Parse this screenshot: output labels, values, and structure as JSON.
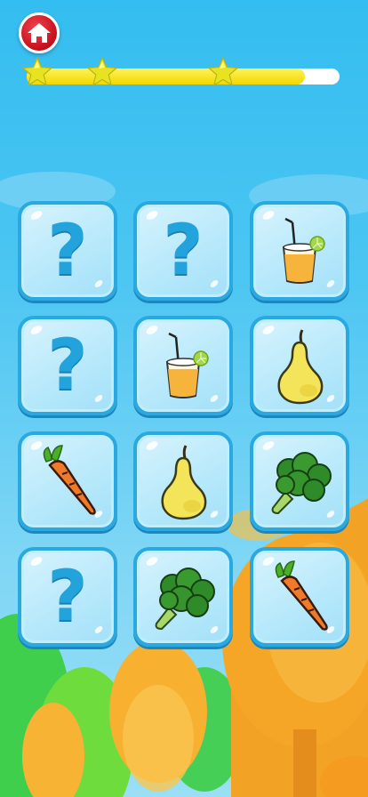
{
  "header": {
    "home_button": {
      "icon": "home-icon"
    }
  },
  "progress": {
    "fraction": 0.89,
    "stars_earned": 3,
    "colors": {
      "fill": "#f7e21a",
      "track": "#ffffff",
      "star": "#e8e320"
    }
  },
  "board": {
    "rows": 4,
    "columns": 3,
    "cards": [
      {
        "state": "hidden",
        "symbol": "?"
      },
      {
        "state": "hidden",
        "symbol": "?"
      },
      {
        "state": "revealed",
        "item": "juice-icon"
      },
      {
        "state": "hidden",
        "symbol": "?"
      },
      {
        "state": "revealed",
        "item": "juice-icon"
      },
      {
        "state": "revealed",
        "item": "pear-icon"
      },
      {
        "state": "revealed",
        "item": "carrot-icon"
      },
      {
        "state": "revealed",
        "item": "pear-icon"
      },
      {
        "state": "revealed",
        "item": "broccoli-icon"
      },
      {
        "state": "hidden",
        "symbol": "?"
      },
      {
        "state": "revealed",
        "item": "broccoli-icon"
      },
      {
        "state": "revealed",
        "item": "carrot-icon"
      }
    ]
  }
}
